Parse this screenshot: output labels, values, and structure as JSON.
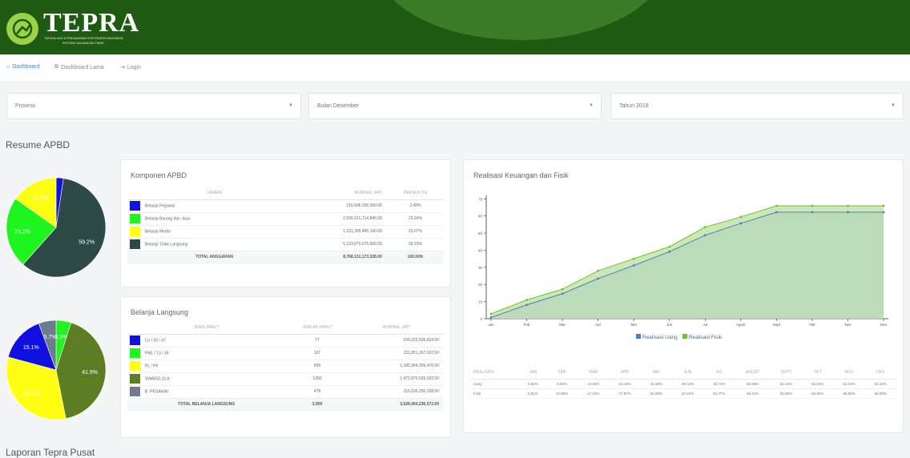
{
  "header": {
    "brand": "TEPRA",
    "subtitle_line1": "TIM EVALUASI & PENGAWASAN PENYERAPAN ANGGARAN",
    "subtitle_line2": "PROVINSI KALIMANTAN TIMUR"
  },
  "nav": {
    "items": [
      {
        "label": "Dashboard",
        "icon": "dashboard-icon",
        "active": true
      },
      {
        "label": "Dashboard Lama",
        "icon": "external-link-icon",
        "active": false
      },
      {
        "label": "Login",
        "icon": "login-icon",
        "active": false
      }
    ]
  },
  "filters": {
    "provinsi": "Provinsi",
    "bulan": "Bulan Desember",
    "tahun": "Tahun 2018"
  },
  "resume_title": "Resume APBD",
  "laporan_title": "Laporan Tepra Pusat",
  "pie1": {
    "slices": [
      {
        "value": 2.4,
        "label": "",
        "color": "#1010e0"
      },
      {
        "value": 59.2,
        "label": "59.2%",
        "color": "#2e4a47"
      },
      {
        "value": 23.2,
        "label": "23.2%",
        "color": "#1ef51e"
      },
      {
        "value": 15.2,
        "label": "15.2%",
        "color": "#ffff11"
      }
    ]
  },
  "pie2": {
    "slices": [
      {
        "value": 4.9,
        "label": "4.9%",
        "color": "#1ef51e"
      },
      {
        "value": 41.9,
        "label": "41.9%",
        "color": "#5d7d24"
      },
      {
        "value": 32.3,
        "label": "32.3%",
        "color": "#ffff11"
      },
      {
        "value": 15.1,
        "label": "15.1%",
        "color": "#1010e0"
      },
      {
        "value": 5.7,
        "label": "5.7%",
        "color": "#6d7b8d"
      }
    ]
  },
  "komponen": {
    "title": "Komponen APBD",
    "headers": [
      "URAIAN",
      "NOMINAL (RP)",
      "PERSEN (%)"
    ],
    "rows": [
      {
        "color": "#1010e0",
        "label": "Belanja Pegawai",
        "nominal": "216,606,200,000.00",
        "persen": "2.49%"
      },
      {
        "color": "#1ef51e",
        "label": "Belanja Barang dan Jasa",
        "nominal": "2,036,121,714,846.00",
        "persen": "23.24%"
      },
      {
        "color": "#ffff11",
        "label": "Belanja Modal",
        "nominal": "1,321,305,485,160.00",
        "persen": "15.07%"
      },
      {
        "color": "#2e4a47",
        "label": "Belanja Tidak Langsung",
        "nominal": "5,193,673,675,600.00",
        "persen": "59.23%"
      }
    ],
    "total_label": "TOTAL ANGGARAN",
    "total_nominal": "8,768,131,173,328.00",
    "total_persen": "100.00%"
  },
  "belanja": {
    "title": "Belanja Langsung",
    "headers": [
      "JENIS PAKET",
      "JUMLAH PAKET",
      "NOMINAL (RP)"
    ],
    "rows": [
      {
        "color": "#1010e0",
        "label": "LU / 50 / 47",
        "jumlah": "77",
        "nominal": "534,222,505,824.00"
      },
      {
        "color": "#1ef51e",
        "label": "PML / 13 / 35",
        "jumlah": "167",
        "nominal": "211,851,267,022.00"
      },
      {
        "color": "#ffff11",
        "label": "PL / PK",
        "jumlah": "699",
        "nominal": "1,185,964,306,470.00"
      },
      {
        "color": "#5d7d24",
        "label": "SWAKELOLA",
        "jumlah": "1260",
        "nominal": "1,472,879,539,022.00"
      },
      {
        "color": "#6d7b8d",
        "label": "B. PEGAWAI",
        "jumlah": "478",
        "nominal": "215,026,250,328.00"
      }
    ],
    "total_label": "TOTAL BELANJA LANGSUNG",
    "total_jumlah": "2,909",
    "total_nominal": "3,528,064,236,572.00"
  },
  "realisasi": {
    "title": "Realisasi Keuangan dan Fisik",
    "legend_uang": "Realisasi Uang",
    "legend_fisik": "Realisasi Fisik",
    "color_uang": "#4b7fc3",
    "color_fisik": "#6fc13b",
    "table_header": "REALISASI",
    "months_table": [
      "JAN",
      "FEB",
      "MAR",
      "APR",
      "MEI",
      "JUN",
      "JUL",
      "AGUST",
      "SEPT",
      "OKT",
      "NOV",
      "DES"
    ],
    "uang_label": "Uang",
    "fisik_label": "Fisik",
    "uang_row": [
      "0.69%",
      "8.06%",
      "14.60%",
      "23.43%",
      "31.08%",
      "39.13%",
      "48.72%",
      "55.66%",
      "62.16%",
      "62.16%",
      "62.16%",
      "62.16%"
    ],
    "fisik_row": [
      "2.81%",
      "10.99%",
      "17.23%",
      "27.97%",
      "34.99%",
      "42.02%",
      "53.47%",
      "59.41%",
      "65.90%",
      "65.90%",
      "65.90%",
      "65.90%"
    ]
  },
  "chart_data": {
    "type": "area",
    "title": "Realisasi Keuangan dan Fisik",
    "categories": [
      "Jan",
      "Feb",
      "Mar",
      "Apr",
      "Mei",
      "Jun",
      "Jul",
      "Agust",
      "Sept",
      "Okt",
      "Nov",
      "Des"
    ],
    "series": [
      {
        "name": "Realisasi Uang",
        "values": [
          0.69,
          8.06,
          14.6,
          23.43,
          31.08,
          39.13,
          48.72,
          55.66,
          62.16,
          62.16,
          62.16,
          62.16
        ]
      },
      {
        "name": "Realisasi Fisik",
        "values": [
          2.81,
          10.99,
          17.23,
          27.97,
          34.99,
          42.02,
          53.47,
          59.41,
          65.9,
          65.9,
          65.9,
          65.9
        ]
      }
    ],
    "yticks": [
      0,
      10,
      20,
      30,
      40,
      50,
      60,
      70
    ],
    "ylim": [
      0,
      72
    ],
    "legend": "bottom-center",
    "grid": false
  }
}
